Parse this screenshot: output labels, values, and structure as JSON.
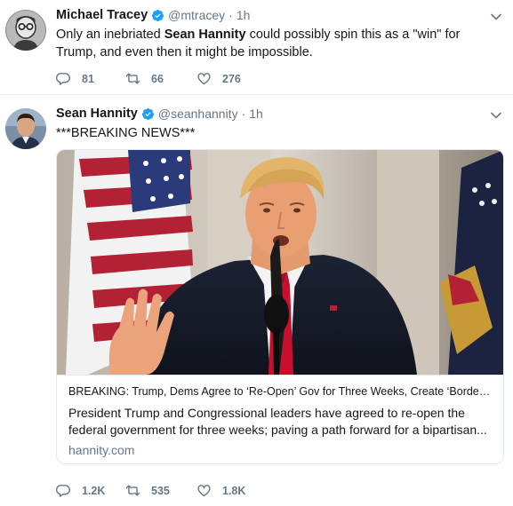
{
  "colors": {
    "verified_blue": "#1da1f2",
    "secondary_text": "#657786",
    "primary_text": "#14171a",
    "divider": "#e6ecf0"
  },
  "tweets": [
    {
      "author_name": "Michael Tracey",
      "author_handle": "@mtracey",
      "separator": "·",
      "time": "1h",
      "text_before": "Only an inebriated ",
      "text_bold": "Sean Hannity",
      "text_after": " could possibly spin this as a \"win\" for Trump, and even then it might be impossible.",
      "replies": "81",
      "retweets": "66",
      "likes": "276",
      "icons": [
        "reply-icon",
        "retweet-icon",
        "like-icon",
        "verified-icon",
        "caret-down-icon"
      ]
    },
    {
      "author_name": "Sean Hannity",
      "author_handle": "@seanhannity",
      "separator": "·",
      "time": "1h",
      "text": "***BREAKING NEWS***",
      "card": {
        "title": "BREAKING: Trump, Dems Agree to ‘Re-Open’ Gov for Three Weeks, Create ‘Border Security’ Committee",
        "description": "President Trump and Congressional leaders have agreed to re-open the federal government for three weeks; paving a path forward for a bipartisan...",
        "domain": "hannity.com"
      },
      "replies": "1.2K",
      "retweets": "535",
      "likes": "1.8K"
    }
  ]
}
